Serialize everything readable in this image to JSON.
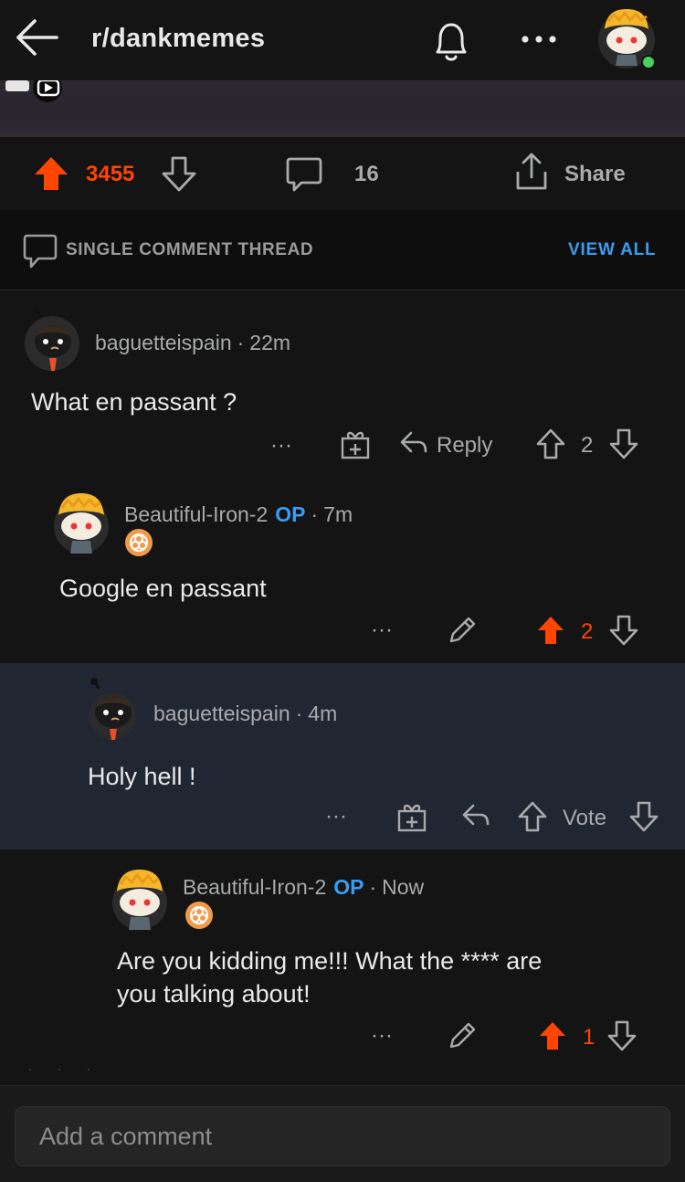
{
  "header": {
    "subreddit": "r/dankmemes",
    "back_icon": "back-arrow-icon",
    "bell_icon": "bell-icon",
    "more_icon": "more-dots-icon",
    "online_color": "#46d160"
  },
  "post_actions": {
    "score": "3455",
    "comment_count": "16",
    "share_label": "Share",
    "upvote_color": "#ff4500"
  },
  "thread": {
    "label": "SINGLE COMMENT THREAD",
    "view_all": "VIEW ALL"
  },
  "comments": [
    {
      "author": "baguetteispain",
      "time": "22m",
      "op": "",
      "body": "What en passant ?",
      "more": "···",
      "reply": "Reply",
      "score": "2",
      "voted": false
    },
    {
      "author": "Beautiful-Iron-2",
      "op": "OP",
      "time": "7m",
      "body": "Google en passant",
      "more": "···",
      "score": "2",
      "voted": true
    },
    {
      "author": "baguetteispain",
      "time": "4m",
      "op": "",
      "body": "Holy hell !",
      "more": "···",
      "score": "Vote",
      "voted": false
    },
    {
      "author": "Beautiful-Iron-2",
      "op": "OP",
      "time": "Now",
      "body_line1": "Are you kidding me!!! What the **** are",
      "body_line2": "you talking about!",
      "more": "···",
      "score": "1",
      "voted": true
    }
  ],
  "composer": {
    "placeholder": "Add a comment"
  }
}
